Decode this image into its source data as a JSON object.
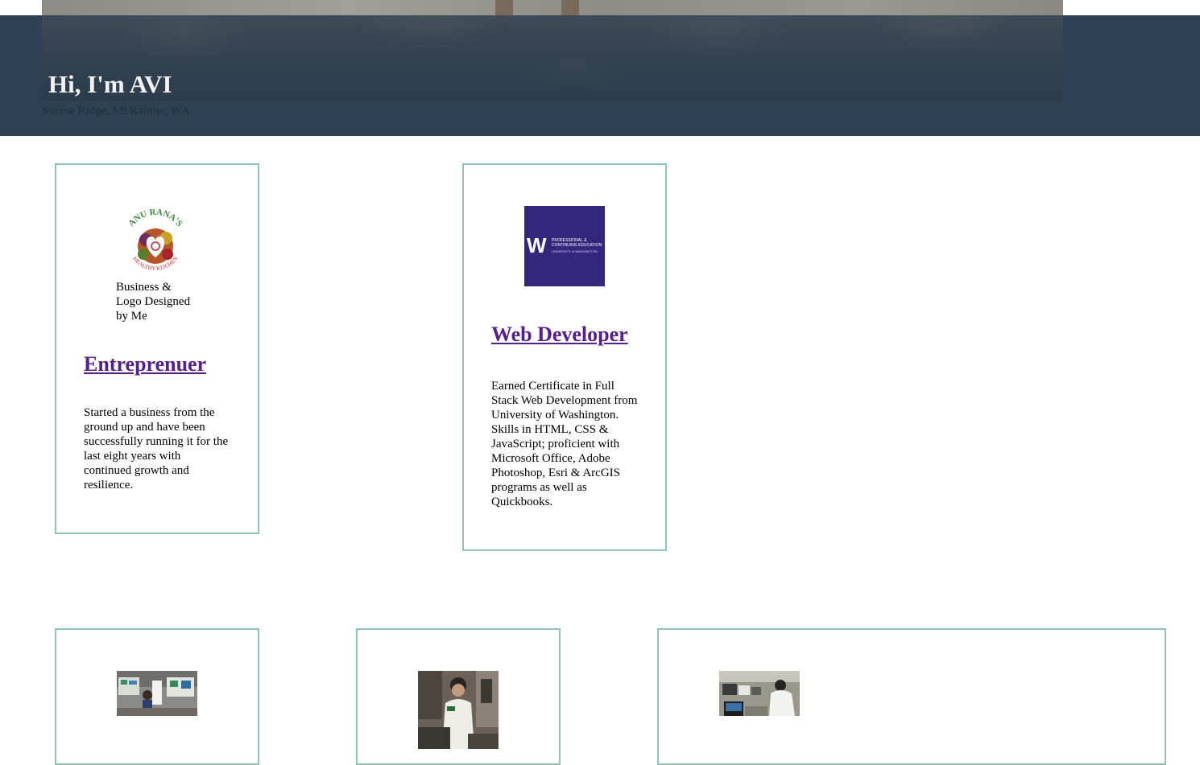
{
  "hero": {
    "title": "Hi, I'm AVI",
    "caption": "Sunrse Ridge, Mt Rainier, WA"
  },
  "cards": {
    "entrepreneur": {
      "logo_caption": [
        "Business &",
        "Logo Designed",
        "by Me"
      ],
      "logo_text_top": "ANU RANA'S",
      "logo_text_bottom": "HEALTHY KITCHEN",
      "title": "Entreprenuer",
      "text": "Started a business from the ground up and have been successfully running it for the last eight years with continued growth and resilience."
    },
    "web_developer": {
      "logo_w": "W",
      "logo_line1": "PROFESSIONAL &",
      "logo_line2": "CONTINUING EDUCATION",
      "logo_line3": "UNIVERSITY of WASHINGTON",
      "title": "Web Developer",
      "text": "Earned Certificate in Full Stack Web Development from University of Washington. Skills in HTML, CSS & JavaScript; proficient with Microsoft Office, Adobe Photoshop, Esri & ArcGIS programs as well as Quickbooks."
    }
  },
  "colors": {
    "hero_band": "#2f4255",
    "card_border": "#8fc3b6",
    "link": "#55208a",
    "uw_purple": "#33267d"
  }
}
